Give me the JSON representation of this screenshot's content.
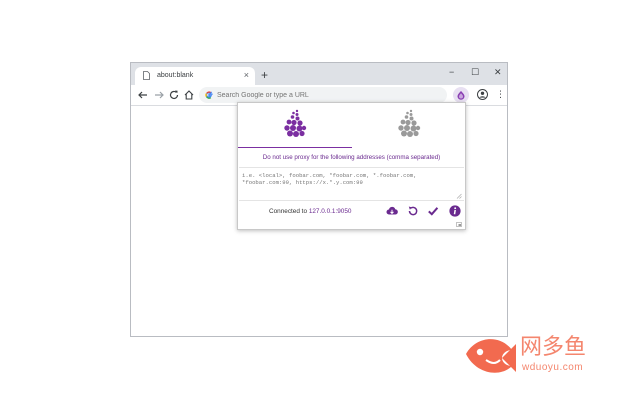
{
  "browser": {
    "tab_title": "about:blank",
    "new_tab": "+",
    "tab_close": "×",
    "window_controls": {
      "minimize": "−",
      "maximize": "☐",
      "close": "✕"
    },
    "omnibox_placeholder": "Search Google or type a URL",
    "menu": "⋮"
  },
  "popup": {
    "modes": [
      {
        "name": "proxy",
        "color": "#7b2fa1",
        "active": true
      },
      {
        "name": "direct",
        "color": "#9a9a9a",
        "active": false
      }
    ],
    "caption": "Do not use proxy for the following addresses (comma separated)",
    "bypass_placeholder": "i.e. <local>, foobar.com, *foobar.com, *.foobar.com, *foobar.com:99, https://x.*.y.com:99",
    "status_prefix": "Connected to",
    "status_address": "127.0.0.1:9050",
    "actions": [
      "cloud-download-icon",
      "refresh-icon",
      "check-icon",
      "info-icon"
    ]
  },
  "watermark": {
    "cn": "网多鱼",
    "en": "wduoyu.com",
    "color": "#f4866e"
  },
  "colors": {
    "accent": "#7b2fa1",
    "muted": "#9a9a9a",
    "tabstrip": "#dee1e6"
  }
}
